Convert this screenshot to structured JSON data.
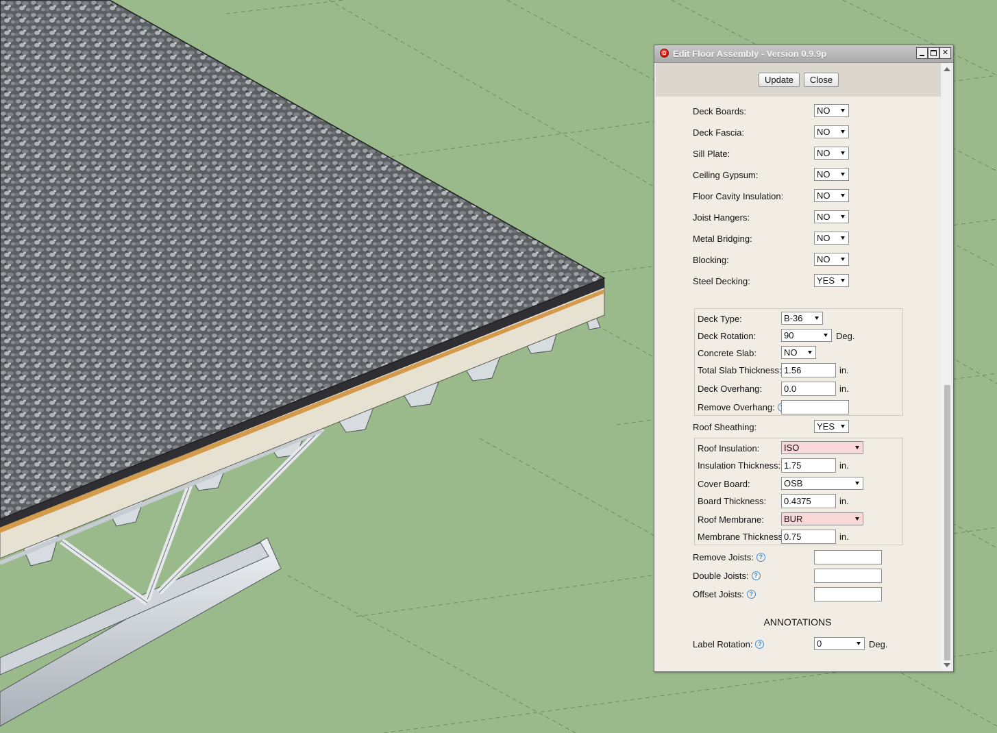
{
  "window": {
    "title": "Edit Floor Assembly - Version 0.9.9p",
    "icon": "sketchup-icon",
    "controls": [
      "minimize",
      "maximize",
      "close"
    ]
  },
  "toolbar": {
    "update_label": "Update",
    "close_label": "Close"
  },
  "fields": {
    "deck_boards": {
      "label": "Deck Boards:",
      "value": "NO"
    },
    "deck_fascia": {
      "label": "Deck Fascia:",
      "value": "NO"
    },
    "sill_plate": {
      "label": "Sill Plate:",
      "value": "NO"
    },
    "ceiling_gypsum": {
      "label": "Ceiling Gypsum:",
      "value": "NO"
    },
    "floor_cavity_insulation": {
      "label": "Floor Cavity Insulation:",
      "value": "NO"
    },
    "joist_hangers": {
      "label": "Joist Hangers:",
      "value": "NO"
    },
    "metal_bridging": {
      "label": "Metal Bridging:",
      "value": "NO"
    },
    "blocking": {
      "label": "Blocking:",
      "value": "NO"
    },
    "steel_decking": {
      "label": "Steel Decking:",
      "value": "YES"
    }
  },
  "steel_deck_group": {
    "deck_type": {
      "label": "Deck Type:",
      "value": "B-36"
    },
    "deck_rotation": {
      "label": "Deck Rotation:",
      "value": "90",
      "unit": "Deg."
    },
    "concrete_slab": {
      "label": "Concrete Slab:",
      "value": "NO"
    },
    "total_slab_thickness": {
      "label": "Total Slab Thickness:",
      "value": "1.56",
      "unit": "in."
    },
    "deck_overhang": {
      "label": "Deck Overhang:",
      "value": "0.0",
      "unit": "in."
    },
    "remove_overhang": {
      "label": "Remove Overhang:",
      "value": ""
    }
  },
  "roof_sheathing": {
    "label": "Roof Sheathing:",
    "value": "YES"
  },
  "roof_group": {
    "roof_insulation": {
      "label": "Roof Insulation:",
      "value": "ISO"
    },
    "insulation_thickness": {
      "label": "Insulation Thickness:",
      "value": "1.75",
      "unit": "in."
    },
    "cover_board": {
      "label": "Cover Board:",
      "value": "OSB"
    },
    "board_thickness": {
      "label": "Board Thickness:",
      "value": "0.4375",
      "unit": "in."
    },
    "roof_membrane": {
      "label": "Roof Membrane:",
      "value": "BUR"
    },
    "membrane_thickness": {
      "label": "Membrane Thickness:",
      "value": "0.75",
      "unit": "in."
    }
  },
  "joist_edits": {
    "remove_joists": {
      "label": "Remove Joists:",
      "value": ""
    },
    "double_joists": {
      "label": "Double Joists:",
      "value": ""
    },
    "offset_joists": {
      "label": "Offset Joists:",
      "value": ""
    }
  },
  "annotations": {
    "heading": "ANNOTATIONS",
    "label_rotation": {
      "label": "Label Rotation:",
      "value": "0",
      "unit": "Deg."
    }
  },
  "help_glyph": "?",
  "colors": {
    "ground": "#9aba8c",
    "grid": "#6c8a62",
    "highlight_select": "#f8d8d8",
    "dialog_bg": "#f1ede5"
  }
}
